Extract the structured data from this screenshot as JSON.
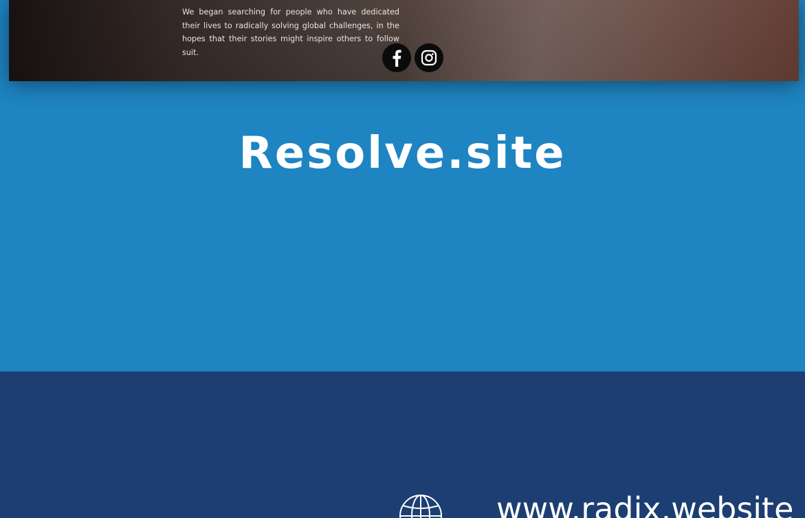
{
  "hero": {
    "description": "We began searching for people who have dedicated their lives to radically solving global challenges, in the hopes that their stories might inspire others to follow suit.",
    "social": [
      {
        "icon": "facebook-icon"
      },
      {
        "icon": "instagram-icon"
      }
    ]
  },
  "main": {
    "title": "Resolve.site"
  },
  "footer": {
    "icon": "globe-icon",
    "url": "www.radix.website"
  },
  "colors": {
    "section_blue": "#1e84c2",
    "footer_navy": "#1c3e72",
    "text": "#ffffff"
  }
}
